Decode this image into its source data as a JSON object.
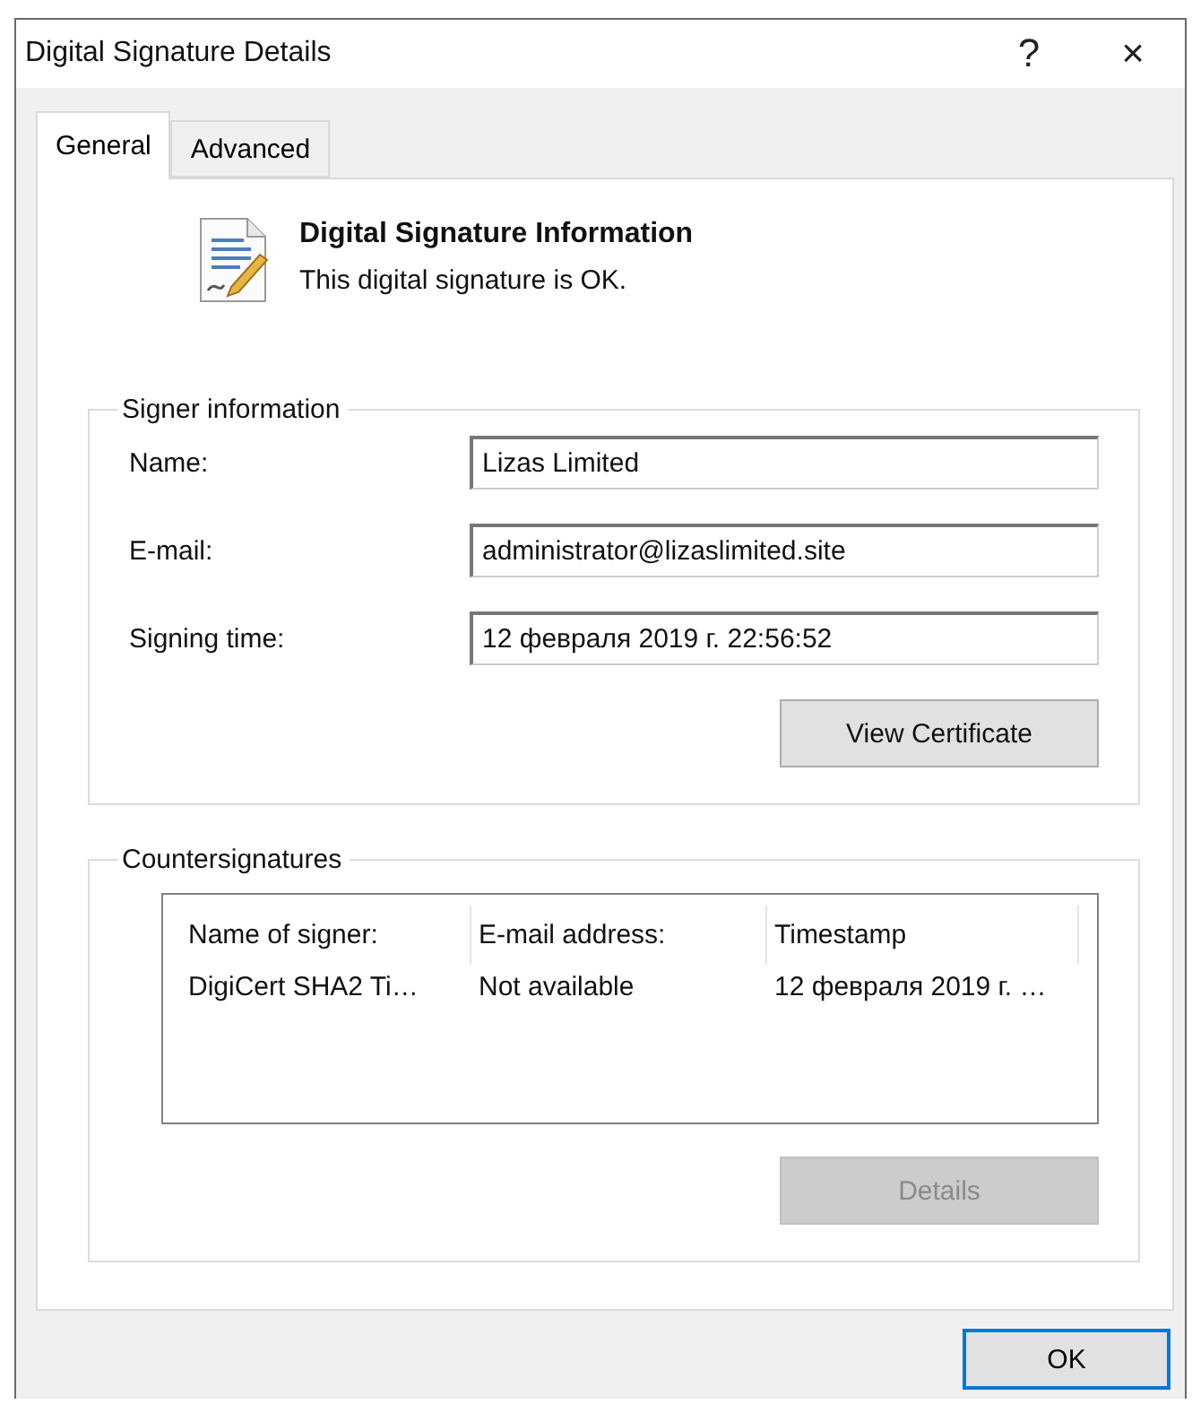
{
  "window": {
    "title": "Digital Signature Details",
    "help": "?",
    "close": "×"
  },
  "tabs": [
    {
      "label": "General",
      "selected": true
    },
    {
      "label": "Advanced",
      "selected": false
    }
  ],
  "header": {
    "title": "Digital Signature Information",
    "status": "This digital signature is OK."
  },
  "signer": {
    "legend": "Signer information",
    "fields": [
      {
        "label": "Name:",
        "value": "Lizas Limited"
      },
      {
        "label": "E-mail:",
        "value": "administrator@lizaslimited.site"
      },
      {
        "label": "Signing time:",
        "value": "12 февраля 2019 г. 22:56:52"
      }
    ],
    "button": {
      "label": "View Certificate",
      "disabled": false
    }
  },
  "countersignatures": {
    "legend": "Countersignatures",
    "columns": [
      "Name of signer:",
      "E-mail address:",
      "Timestamp"
    ],
    "rows": [
      [
        "DigiCert SHA2 Ti…",
        "Not available",
        "12 февраля 2019 г. …"
      ]
    ],
    "button": {
      "label": "Details",
      "disabled": true
    }
  },
  "footer": {
    "button": {
      "label": "OK",
      "default": true
    }
  }
}
